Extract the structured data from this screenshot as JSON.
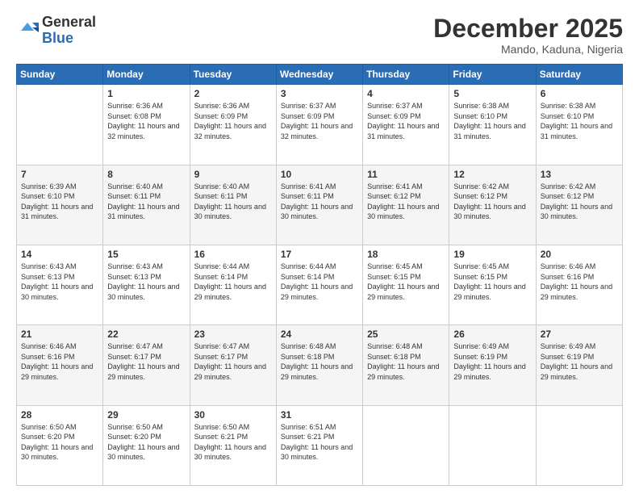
{
  "header": {
    "logo_general": "General",
    "logo_blue": "Blue",
    "month_title": "December 2025",
    "location": "Mando, Kaduna, Nigeria"
  },
  "days_of_week": [
    "Sunday",
    "Monday",
    "Tuesday",
    "Wednesday",
    "Thursday",
    "Friday",
    "Saturday"
  ],
  "weeks": [
    [
      {
        "day": "",
        "sunrise": "",
        "sunset": "",
        "daylight": ""
      },
      {
        "day": "1",
        "sunrise": "Sunrise: 6:36 AM",
        "sunset": "Sunset: 6:08 PM",
        "daylight": "Daylight: 11 hours and 32 minutes."
      },
      {
        "day": "2",
        "sunrise": "Sunrise: 6:36 AM",
        "sunset": "Sunset: 6:09 PM",
        "daylight": "Daylight: 11 hours and 32 minutes."
      },
      {
        "day": "3",
        "sunrise": "Sunrise: 6:37 AM",
        "sunset": "Sunset: 6:09 PM",
        "daylight": "Daylight: 11 hours and 32 minutes."
      },
      {
        "day": "4",
        "sunrise": "Sunrise: 6:37 AM",
        "sunset": "Sunset: 6:09 PM",
        "daylight": "Daylight: 11 hours and 31 minutes."
      },
      {
        "day": "5",
        "sunrise": "Sunrise: 6:38 AM",
        "sunset": "Sunset: 6:10 PM",
        "daylight": "Daylight: 11 hours and 31 minutes."
      },
      {
        "day": "6",
        "sunrise": "Sunrise: 6:38 AM",
        "sunset": "Sunset: 6:10 PM",
        "daylight": "Daylight: 11 hours and 31 minutes."
      }
    ],
    [
      {
        "day": "7",
        "sunrise": "Sunrise: 6:39 AM",
        "sunset": "Sunset: 6:10 PM",
        "daylight": "Daylight: 11 hours and 31 minutes."
      },
      {
        "day": "8",
        "sunrise": "Sunrise: 6:40 AM",
        "sunset": "Sunset: 6:11 PM",
        "daylight": "Daylight: 11 hours and 31 minutes."
      },
      {
        "day": "9",
        "sunrise": "Sunrise: 6:40 AM",
        "sunset": "Sunset: 6:11 PM",
        "daylight": "Daylight: 11 hours and 30 minutes."
      },
      {
        "day": "10",
        "sunrise": "Sunrise: 6:41 AM",
        "sunset": "Sunset: 6:11 PM",
        "daylight": "Daylight: 11 hours and 30 minutes."
      },
      {
        "day": "11",
        "sunrise": "Sunrise: 6:41 AM",
        "sunset": "Sunset: 6:12 PM",
        "daylight": "Daylight: 11 hours and 30 minutes."
      },
      {
        "day": "12",
        "sunrise": "Sunrise: 6:42 AM",
        "sunset": "Sunset: 6:12 PM",
        "daylight": "Daylight: 11 hours and 30 minutes."
      },
      {
        "day": "13",
        "sunrise": "Sunrise: 6:42 AM",
        "sunset": "Sunset: 6:12 PM",
        "daylight": "Daylight: 11 hours and 30 minutes."
      }
    ],
    [
      {
        "day": "14",
        "sunrise": "Sunrise: 6:43 AM",
        "sunset": "Sunset: 6:13 PM",
        "daylight": "Daylight: 11 hours and 30 minutes."
      },
      {
        "day": "15",
        "sunrise": "Sunrise: 6:43 AM",
        "sunset": "Sunset: 6:13 PM",
        "daylight": "Daylight: 11 hours and 30 minutes."
      },
      {
        "day": "16",
        "sunrise": "Sunrise: 6:44 AM",
        "sunset": "Sunset: 6:14 PM",
        "daylight": "Daylight: 11 hours and 29 minutes."
      },
      {
        "day": "17",
        "sunrise": "Sunrise: 6:44 AM",
        "sunset": "Sunset: 6:14 PM",
        "daylight": "Daylight: 11 hours and 29 minutes."
      },
      {
        "day": "18",
        "sunrise": "Sunrise: 6:45 AM",
        "sunset": "Sunset: 6:15 PM",
        "daylight": "Daylight: 11 hours and 29 minutes."
      },
      {
        "day": "19",
        "sunrise": "Sunrise: 6:45 AM",
        "sunset": "Sunset: 6:15 PM",
        "daylight": "Daylight: 11 hours and 29 minutes."
      },
      {
        "day": "20",
        "sunrise": "Sunrise: 6:46 AM",
        "sunset": "Sunset: 6:16 PM",
        "daylight": "Daylight: 11 hours and 29 minutes."
      }
    ],
    [
      {
        "day": "21",
        "sunrise": "Sunrise: 6:46 AM",
        "sunset": "Sunset: 6:16 PM",
        "daylight": "Daylight: 11 hours and 29 minutes."
      },
      {
        "day": "22",
        "sunrise": "Sunrise: 6:47 AM",
        "sunset": "Sunset: 6:17 PM",
        "daylight": "Daylight: 11 hours and 29 minutes."
      },
      {
        "day": "23",
        "sunrise": "Sunrise: 6:47 AM",
        "sunset": "Sunset: 6:17 PM",
        "daylight": "Daylight: 11 hours and 29 minutes."
      },
      {
        "day": "24",
        "sunrise": "Sunrise: 6:48 AM",
        "sunset": "Sunset: 6:18 PM",
        "daylight": "Daylight: 11 hours and 29 minutes."
      },
      {
        "day": "25",
        "sunrise": "Sunrise: 6:48 AM",
        "sunset": "Sunset: 6:18 PM",
        "daylight": "Daylight: 11 hours and 29 minutes."
      },
      {
        "day": "26",
        "sunrise": "Sunrise: 6:49 AM",
        "sunset": "Sunset: 6:19 PM",
        "daylight": "Daylight: 11 hours and 29 minutes."
      },
      {
        "day": "27",
        "sunrise": "Sunrise: 6:49 AM",
        "sunset": "Sunset: 6:19 PM",
        "daylight": "Daylight: 11 hours and 29 minutes."
      }
    ],
    [
      {
        "day": "28",
        "sunrise": "Sunrise: 6:50 AM",
        "sunset": "Sunset: 6:20 PM",
        "daylight": "Daylight: 11 hours and 30 minutes."
      },
      {
        "day": "29",
        "sunrise": "Sunrise: 6:50 AM",
        "sunset": "Sunset: 6:20 PM",
        "daylight": "Daylight: 11 hours and 30 minutes."
      },
      {
        "day": "30",
        "sunrise": "Sunrise: 6:50 AM",
        "sunset": "Sunset: 6:21 PM",
        "daylight": "Daylight: 11 hours and 30 minutes."
      },
      {
        "day": "31",
        "sunrise": "Sunrise: 6:51 AM",
        "sunset": "Sunset: 6:21 PM",
        "daylight": "Daylight: 11 hours and 30 minutes."
      },
      {
        "day": "",
        "sunrise": "",
        "sunset": "",
        "daylight": ""
      },
      {
        "day": "",
        "sunrise": "",
        "sunset": "",
        "daylight": ""
      },
      {
        "day": "",
        "sunrise": "",
        "sunset": "",
        "daylight": ""
      }
    ]
  ]
}
